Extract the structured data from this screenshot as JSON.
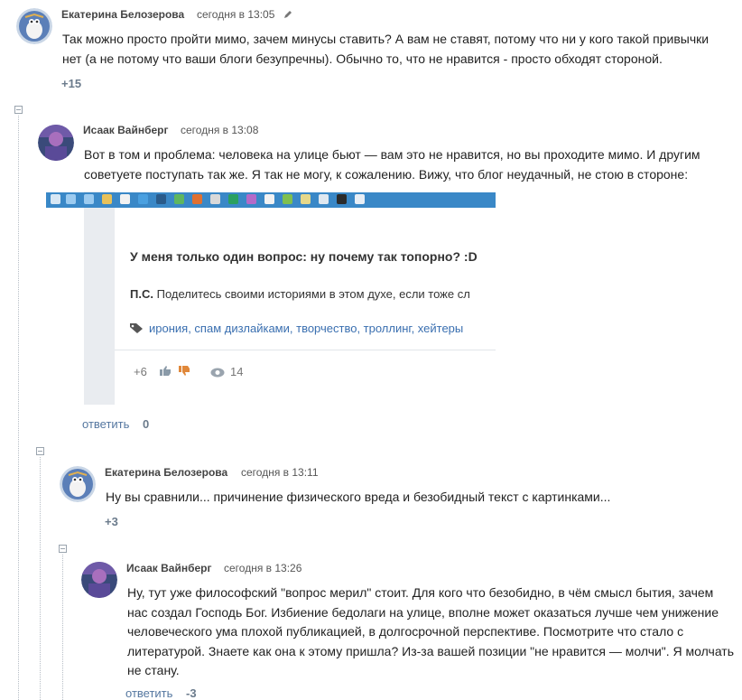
{
  "comments": [
    {
      "author": "Екатерина Белозерова",
      "time": "сегодня в 13:05",
      "lines": [
        "Так можно просто пройти мимо, зачем минусы ставить? А вам не ставят, потому что ни у кого такой привычки",
        "нет (а не потому что ваши блоги безупречны). Обычно то, что не нравится - просто обходят стороной."
      ],
      "score": "+15"
    },
    {
      "author": "Исаак Вайнберг",
      "time": "сегодня в 13:08",
      "lines": [
        "Вот в том и проблема: человека на улице бьют — вам это не нравится, но вы проходите мимо. И другим",
        "советуете поступать так же. Я так не могу, к сожалению. Вижу, что блог неудачный, не стою в стороне:"
      ],
      "reply": "ответить",
      "score": "0"
    },
    {
      "author": "Екатерина Белозерова",
      "time": "сегодня в 13:11",
      "lines": [
        "Ну вы сравнили... причинение физического вреда и безобидный текст с картинками..."
      ],
      "score": "+3"
    },
    {
      "author": "Исаак Вайнберг",
      "time": "сегодня в 13:26",
      "lines": [
        "Ну, тут уже философский \"вопрос мерил\" стоит. Для кого что безобидно, в чём смысл бытия, зачем",
        "нас создал Господь Бог. Избиение бедолаги на улице, вполне может оказаться лучше чем унижение",
        "человеческого ума плохой публикацией, в долгосрочной перспективе. Посмотрите что стало с",
        "литературой. Знаете как она к этому пришла? Из-за вашей позиции \"не нравится — молчи\". Я молчать",
        "не стану."
      ],
      "reply": "ответить",
      "score": "-3"
    }
  ],
  "embedded": {
    "question": "У меня только один вопрос: ну почему так топорно? :D",
    "ps_label": "П.С.",
    "ps_text": "Поделитесь своими историями в этом духе, если тоже сл",
    "tags": "ирония, спам дизлайками, творчество, троллинг, хейтеры",
    "votes": "+6",
    "views": "14"
  },
  "colors": {
    "taskbar": "#3a88c7",
    "link": "#5577a0",
    "tags": "#3a6fb0"
  },
  "icons": [
    "pencil-icon",
    "collapse-icon",
    "tag-icon",
    "thumbs-up-icon",
    "thumbs-down-icon",
    "eye-icon"
  ]
}
